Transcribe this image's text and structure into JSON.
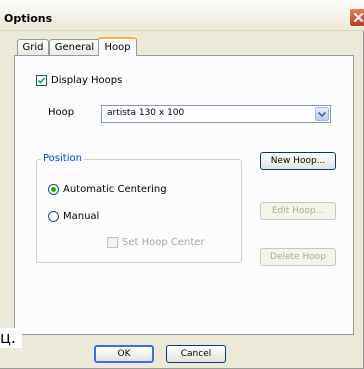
{
  "window": {
    "title": "Options"
  },
  "tabs": [
    {
      "label": "Grid"
    },
    {
      "label": "General"
    },
    {
      "label": "Hoop"
    }
  ],
  "display_hoops": {
    "label": "Display Hoops",
    "checked": true
  },
  "hoop": {
    "label": "Hoop",
    "selected": "artista 130 x 100"
  },
  "position": {
    "title": "Position",
    "automatic_centering": "Automatic Centering",
    "manual": "Manual",
    "set_hoop_center": "Set Hoop Center"
  },
  "buttons": {
    "new_hoop": "New Hoop...",
    "edit_hoop": "Edit Hoop...",
    "delete_hoop": "Delete Hoop",
    "ok": "OK",
    "cancel": "Cancel"
  },
  "stray_text": "ц.",
  "colors": {
    "accent": "#0046d5",
    "radio_dot": "#21a121",
    "close_button": "#c13b1b",
    "tab_highlight": "#f6b53e"
  },
  "icons": [
    "close-icon",
    "checkmark-icon",
    "dropdown-arrow-icon"
  ]
}
